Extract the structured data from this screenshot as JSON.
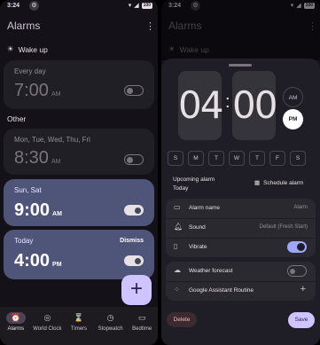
{
  "status": {
    "time": "3:24",
    "battery": "100"
  },
  "left": {
    "title": "Alarms",
    "wake_up": "Wake up",
    "other": "Other",
    "alarms": [
      {
        "days": "Every day",
        "time": "7:00",
        "ampm": "AM",
        "enabled": false
      },
      {
        "days": "Mon, Tue, Wed, Thu, Fri",
        "time": "8:30",
        "ampm": "AM",
        "enabled": false
      },
      {
        "days": "Sun, Sat",
        "time": "9:00",
        "ampm": "AM",
        "enabled": true
      },
      {
        "days": "Today",
        "time": "4:00",
        "ampm": "PM",
        "enabled": true,
        "action": "Dismiss"
      }
    ],
    "fab": "+",
    "nav": [
      {
        "label": "Alarms",
        "icon": "alarm-icon",
        "selected": true
      },
      {
        "label": "World Clock",
        "icon": "globe-icon",
        "selected": false
      },
      {
        "label": "Timers",
        "icon": "hourglass-icon",
        "selected": false
      },
      {
        "label": "Stopwatch",
        "icon": "stopwatch-icon",
        "selected": false
      },
      {
        "label": "Bedtime",
        "icon": "bed-icon",
        "selected": false
      }
    ]
  },
  "right": {
    "title": "Alarms",
    "wake_up": "Wake up",
    "hour": "04",
    "minute": "00",
    "am": "AM",
    "pm": "PM",
    "weekdays": [
      "S",
      "M",
      "T",
      "W",
      "T",
      "F",
      "S"
    ],
    "upcoming_label": "Upcoming alarm",
    "upcoming_day": "Today",
    "schedule": "Schedule alarm",
    "alarm_name_label": "Alarm name",
    "alarm_name_value": "Alarm",
    "sound_label": "Sound",
    "sound_value": "Default (Fresh Start)",
    "vibrate_label": "Vibrate",
    "weather_label": "Weather forecast",
    "assistant_label": "Google Assistant Routine",
    "delete": "Delete",
    "save": "Save"
  },
  "colors": {
    "accent": "#cfc4ff",
    "active_card": "#4f5479",
    "background": "#141218"
  }
}
